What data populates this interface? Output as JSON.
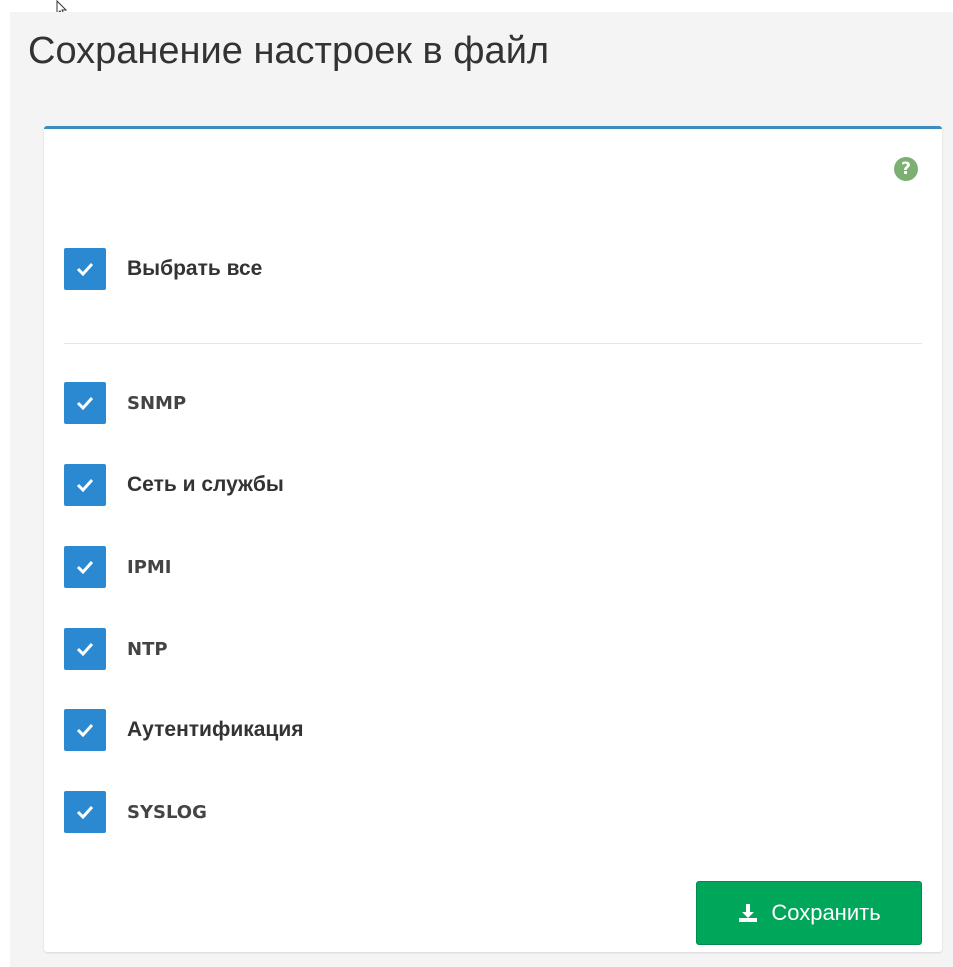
{
  "page": {
    "title": "Сохранение настроек в файл"
  },
  "panel": {
    "help_icon": "question-circle-icon",
    "select_all": {
      "label": "Выбрать все",
      "checked": true
    },
    "items": [
      {
        "label": "SNMP",
        "checked": true
      },
      {
        "label": "Сеть и службы",
        "checked": true
      },
      {
        "label": "IPMI",
        "checked": true
      },
      {
        "label": "NTP",
        "checked": true
      },
      {
        "label": "Аутентификация",
        "checked": true
      },
      {
        "label": "SYSLOG",
        "checked": true
      }
    ],
    "save_button": {
      "label": "Сохранить",
      "icon": "download-icon"
    }
  },
  "colors": {
    "accent": "#3c8dbc",
    "checkbox": "#2a89d0",
    "save_button": "#00a65a",
    "help_icon": "#7cb073"
  }
}
